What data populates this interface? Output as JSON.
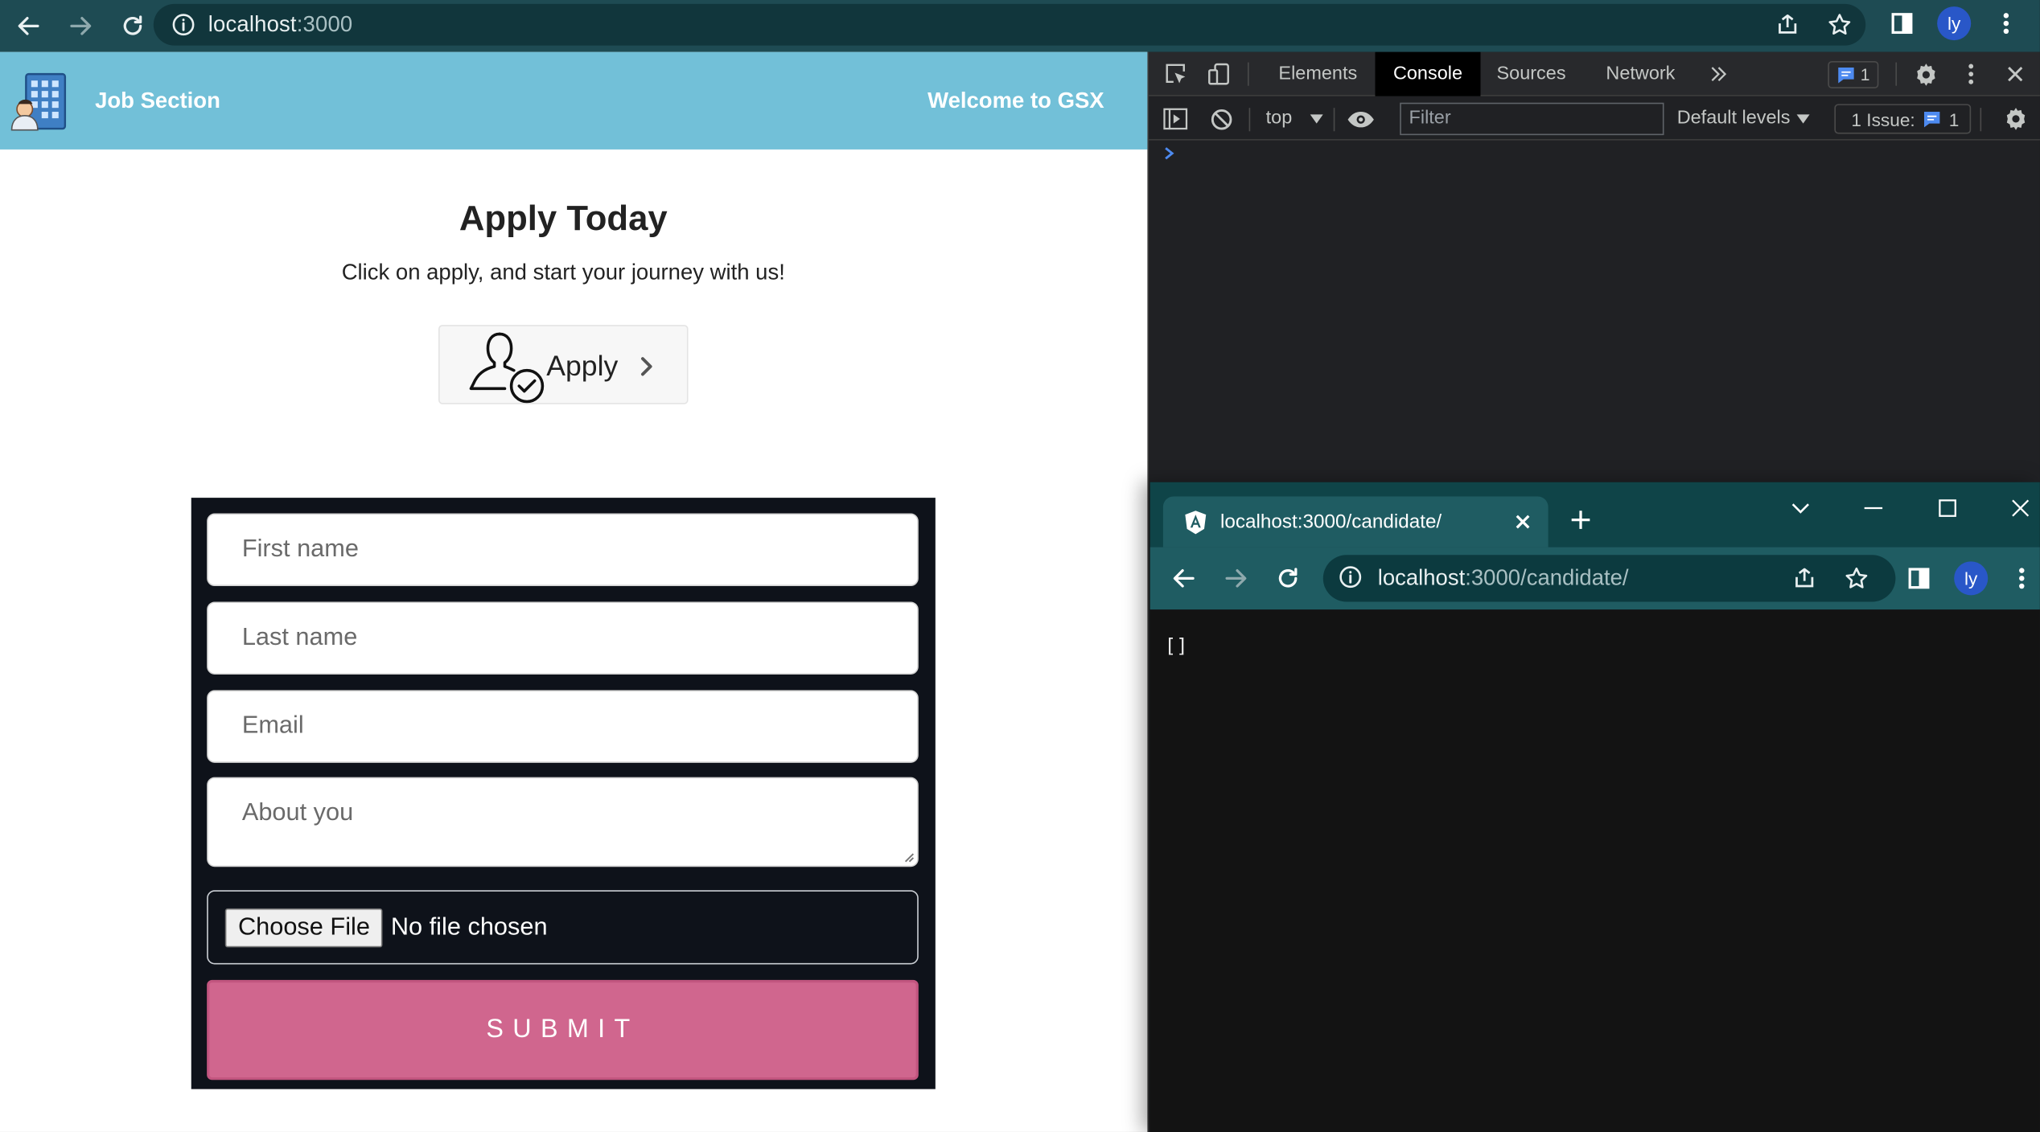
{
  "browser": {
    "url_host": "localhost",
    "url_path": ":3000",
    "profile_initials": "ly"
  },
  "header": {
    "brand": "Job Section",
    "welcome": "Welcome to GSX"
  },
  "hero": {
    "title": "Apply Today",
    "subtitle": "Click on apply, and start your journey with us!",
    "apply_label": "Apply"
  },
  "form": {
    "first_name_placeholder": "First name",
    "last_name_placeholder": "Last name",
    "email_placeholder": "Email",
    "about_placeholder": "About you",
    "choose_file_label": "Choose File",
    "no_file_text": "No file chosen",
    "submit_label": "SUBMIT"
  },
  "devtools": {
    "tabs": [
      "Elements",
      "Console",
      "Sources",
      "Network"
    ],
    "active_tab": "Console",
    "message_badge_count": "1",
    "context": "top",
    "filter_placeholder": "Filter",
    "levels": "Default levels",
    "issues_label": "1 Issue:",
    "issues_count": "1"
  },
  "popup": {
    "tab_title": "localhost:3000/candidate/",
    "url_host": "localhost",
    "url_path": ":3000/candidate/",
    "profile_initials": "ly",
    "body_text": "[]"
  },
  "colors": {
    "toolbar": "#1e4b53",
    "appbar": "#72c0d8",
    "form_bg": "#0e121a",
    "submit": "#d0668e",
    "devtools_bg": "#202124",
    "popup_toolbar": "#1f5c62"
  }
}
